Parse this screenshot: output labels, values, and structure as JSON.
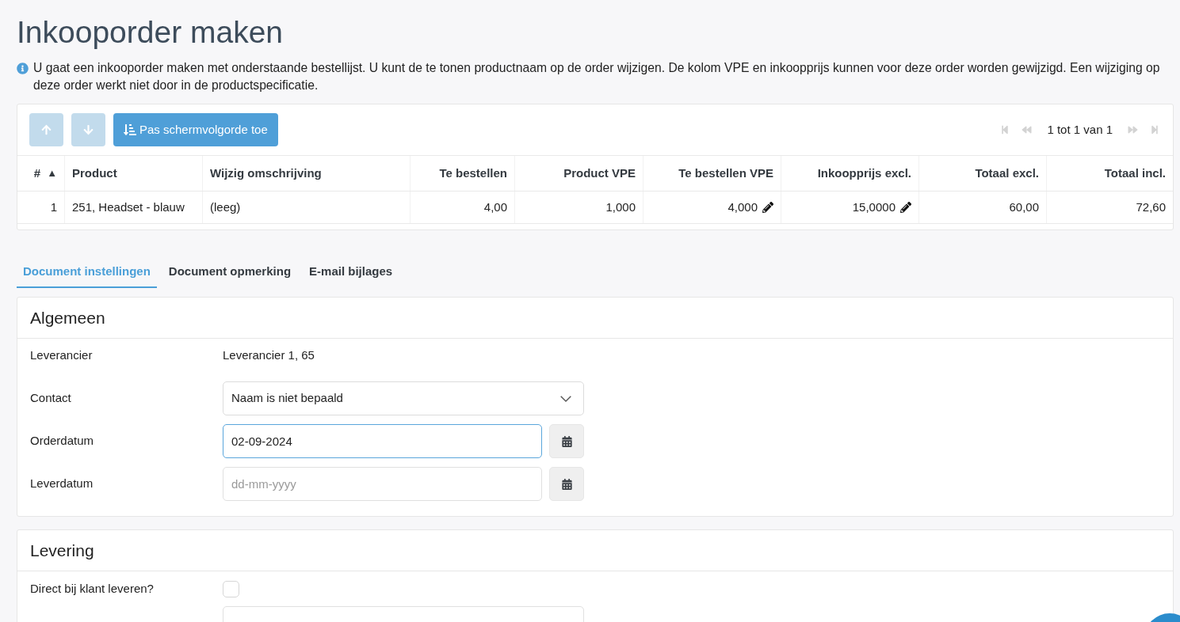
{
  "page": {
    "title": "Inkooporder maken",
    "info": "U gaat een inkooporder maken met onderstaande bestellijst. U kunt de te tonen productnaam op de order wijzigen. De kolom VPE en inkoopprijs kunnen voor deze order worden gewijzigd. Een wijziging op deze order werkt niet door in de productspecificatie."
  },
  "toolbar": {
    "buttons": [
      {
        "kind": "up",
        "disabled": true
      },
      {
        "kind": "down",
        "disabled": true
      },
      {
        "kind": "apply",
        "label": "Pas schermvolgorde toe",
        "disabled": false
      }
    ],
    "pagination": [
      {
        "kind": "first",
        "disabled": true
      },
      {
        "kind": "prev",
        "disabled": true
      },
      {
        "kind": "label",
        "text": "1 tot 1 van 1"
      },
      {
        "kind": "next",
        "disabled": true
      },
      {
        "kind": "last",
        "disabled": true
      }
    ]
  },
  "table": {
    "columns": [
      {
        "label": "#",
        "sort_mark": "▲"
      },
      {
        "label": "Product"
      },
      {
        "label": "Wijzig omschrijving"
      },
      {
        "label": "Te bestellen"
      },
      {
        "label": "Product VPE"
      },
      {
        "label": "Te bestellen VPE"
      },
      {
        "label": "Inkoopprijs excl."
      },
      {
        "label": "Totaal excl."
      },
      {
        "label": "Totaal incl."
      }
    ],
    "rows": [
      {
        "cells": [
          {
            "text": "1",
            "editable": false
          },
          {
            "text": "251, Headset - blauw",
            "editable": false
          },
          {
            "text": "(leeg)",
            "editable": false
          },
          {
            "text": "4,00",
            "editable": false
          },
          {
            "text": "1,000",
            "editable": false
          },
          {
            "text": "4,000",
            "editable": true
          },
          {
            "text": "15,0000",
            "editable": true
          },
          {
            "text": "60,00",
            "editable": false
          },
          {
            "text": "72,60",
            "editable": false
          }
        ]
      }
    ]
  },
  "tabs": [
    {
      "label": "Document instellingen",
      "selected": true
    },
    {
      "label": "Document opmerking",
      "selected": false
    },
    {
      "label": "E-mail bijlages",
      "selected": false
    }
  ],
  "sections": [
    {
      "title": "Algemeen",
      "rows": [
        {
          "kind": "text",
          "label": "Leverancier",
          "value": "Leverancier 1, 65"
        },
        {
          "kind": "select",
          "label": "Contact",
          "value": "Naam is niet bepaald"
        },
        {
          "kind": "date",
          "label": "Orderdatum",
          "value": "02-09-2024",
          "focused": true
        },
        {
          "kind": "date",
          "label": "Leverdatum",
          "placeholder": "dd-mm-yyyy",
          "focused": false
        }
      ]
    },
    {
      "title": "Levering",
      "rows": [
        {
          "kind": "checkbox",
          "label": "Direct bij klant leveren?",
          "checked": false
        },
        {
          "kind": "input"
        }
      ]
    }
  ]
}
